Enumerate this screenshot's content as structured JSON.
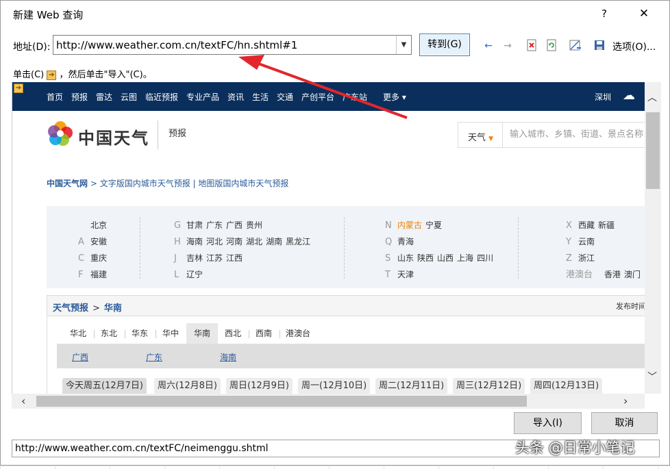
{
  "dialog": {
    "title": "新建 Web 查询",
    "help": "?",
    "close": "✕",
    "address_label": "地址(D):",
    "address_value": "http://www.weather.com.cn/textFC/hn.shtml#1",
    "go_label": "转到(G)",
    "options_label": "选项(O)...",
    "instruction_pre": "单击(C)",
    "instruction_post": "，然后单击\"导入\"(C)。",
    "import_label": "导入(I)",
    "cancel_label": "取消",
    "status_url": "http://www.weather.com.cn/textFC/neimenggu.shtml"
  },
  "webpage": {
    "nav": [
      "首页",
      "预报",
      "雷达",
      "云图",
      "临近预报",
      "专业产品",
      "资讯",
      "生活",
      "交通",
      "产创平台",
      "广东站",
      "更多 ▾"
    ],
    "city": "深圳",
    "logo_text": "中国天气",
    "logo_sub": "预报",
    "search_type": "天气",
    "search_placeholder": "输入城市、乡镇、街道、景点名称",
    "breadcrumb_home": "中国天气网",
    "breadcrumb_rest": " > 文字版国内城市天气预报 | 地图版国内城市天气预报",
    "provinces": {
      "col1": [
        {
          "letter": "",
          "cities": [
            "北京"
          ]
        },
        {
          "letter": "A",
          "cities": [
            "安徽"
          ]
        },
        {
          "letter": "C",
          "cities": [
            "重庆"
          ]
        },
        {
          "letter": "F",
          "cities": [
            "福建"
          ]
        }
      ],
      "col2": [
        {
          "letter": "G",
          "cities": [
            "甘肃",
            "广东",
            "广西",
            "贵州"
          ]
        },
        {
          "letter": "H",
          "cities": [
            "海南",
            "河北",
            "河南",
            "湖北",
            "湖南",
            "黑龙江"
          ]
        },
        {
          "letter": "J",
          "cities": [
            "吉林",
            "江苏",
            "江西"
          ]
        },
        {
          "letter": "L",
          "cities": [
            "辽宁"
          ]
        }
      ],
      "col3": [
        {
          "letter": "N",
          "cities": [
            "内蒙古",
            "宁夏"
          ]
        },
        {
          "letter": "Q",
          "cities": [
            "青海"
          ]
        },
        {
          "letter": "S",
          "cities": [
            "山东",
            "陕西",
            "山西",
            "上海",
            "四川"
          ]
        },
        {
          "letter": "T",
          "cities": [
            "天津"
          ]
        }
      ],
      "col4": [
        {
          "letter": "X",
          "cities": [
            "西藏",
            "新疆"
          ]
        },
        {
          "letter": "Y",
          "cities": [
            "云南"
          ]
        },
        {
          "letter": "Z",
          "cities": [
            "浙江"
          ]
        },
        {
          "letter": "港澳台",
          "cities": [
            "香港",
            "澳门"
          ]
        }
      ]
    },
    "forecast_title": "天气预报",
    "forecast_region": "华南",
    "publish_time": "发布时间",
    "region_tabs": [
      "华北",
      "东北",
      "华东",
      "华中",
      "华南",
      "西北",
      "西南",
      "港澳台"
    ],
    "sub_tabs": [
      "广西",
      "广东",
      "海南"
    ],
    "day_tabs": [
      "今天周五(12月7日)",
      "周六(12月8日)",
      "周日(12月9日)",
      "周一(12月10日)",
      "周二(12月11日)",
      "周三(12月12日)",
      "周四(12月13日)"
    ]
  },
  "watermark": "头条 @日常小笔记",
  "colors": {
    "nav_bg": "#0b2f5c",
    "link": "#2a5b9a",
    "highlight": "#f08300",
    "annotation_arrow": "#e3262b"
  }
}
